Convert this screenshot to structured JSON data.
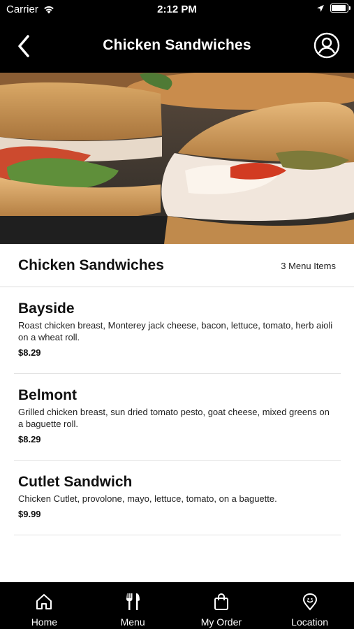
{
  "status_bar": {
    "carrier": "Carrier",
    "time": "2:12 PM"
  },
  "nav": {
    "title": "Chicken Sandwiches",
    "back_icon": "chevron-left-icon",
    "profile_icon": "user-circle-icon"
  },
  "section": {
    "title": "Chicken Sandwiches",
    "count": "3 Menu Items"
  },
  "items": [
    {
      "name": "Bayside",
      "description": "Roast chicken breast, Monterey jack cheese, bacon, lettuce, tomato, herb aioli on a wheat roll.",
      "price": "$8.29"
    },
    {
      "name": "Belmont",
      "description": "Grilled chicken breast, sun dried tomato pesto, goat cheese, mixed greens on a baguette roll.",
      "price": "$8.29"
    },
    {
      "name": "Cutlet Sandwich",
      "description": "Chicken Cutlet, provolone, mayo, lettuce, tomato, on a baguette.",
      "price": "$9.99"
    }
  ],
  "tabs": [
    {
      "label": "Home",
      "icon": "home-icon"
    },
    {
      "label": "Menu",
      "icon": "fork-knife-icon"
    },
    {
      "label": "My Order",
      "icon": "shopping-bag-icon"
    },
    {
      "label": "Location",
      "icon": "map-pin-icon"
    }
  ],
  "colors": {
    "bar_background": "#000000",
    "bar_foreground": "#ffffff",
    "divider": "#dcdcdc"
  }
}
